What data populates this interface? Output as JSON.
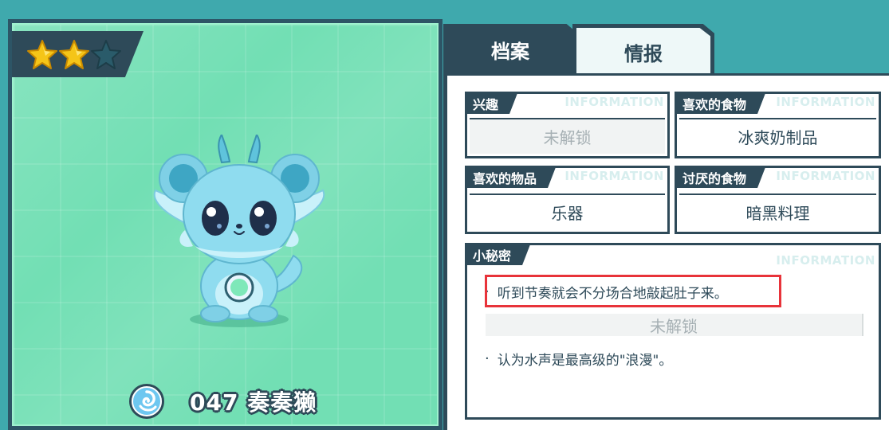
{
  "rating": {
    "filled": 2,
    "total": 3,
    "star_color": "#f5c518",
    "empty_color": "#2a5b6a"
  },
  "creature": {
    "number": "047",
    "name": "奏奏獭",
    "display": "047 奏奏獭",
    "element_icon": "water-swirl-icon"
  },
  "tabs": [
    {
      "label": "档案",
      "active": false
    },
    {
      "label": "情报",
      "active": true
    }
  ],
  "watermark": "INFORMATION",
  "cards": {
    "interest": {
      "label": "兴趣",
      "value": "未解锁",
      "locked": true
    },
    "favorite_food": {
      "label": "喜欢的食物",
      "value": "冰爽奶制品",
      "locked": false
    },
    "favorite_item": {
      "label": "喜欢的物品",
      "value": "乐器",
      "locked": false
    },
    "disliked_food": {
      "label": "讨厌的食物",
      "value": "暗黑料理",
      "locked": false
    }
  },
  "secret": {
    "label": "小秘密",
    "lines": [
      {
        "text": "听到节奏就会不分场合地敲起肚子来。",
        "locked": false,
        "highlighted": true
      },
      {
        "text": "未解锁",
        "locked": true
      },
      {
        "text": "认为水声是最高级的\"浪漫\"。",
        "locked": false
      }
    ]
  },
  "colors": {
    "background": "#3fa9ad",
    "dark": "#2e4a59",
    "portrait_bg": "#72dfb4",
    "highlight": "#e8333a"
  }
}
